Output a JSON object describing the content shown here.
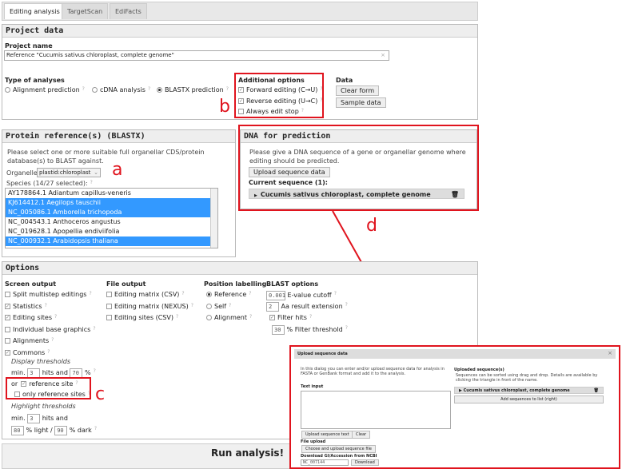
{
  "tabs": [
    "Editing analysis",
    "TargetScan",
    "EdiFacts"
  ],
  "project": {
    "header": "Project data",
    "name_label": "Project name",
    "name_value": "Reference \"Cucumis sativus chloroplast, complete genome\"",
    "clear_x": "×",
    "type_label": "Type of analyses",
    "types": [
      {
        "label": "Alignment prediction",
        "checked": false
      },
      {
        "label": "cDNA analysis",
        "checked": false
      },
      {
        "label": "BLASTX prediction",
        "checked": true
      }
    ],
    "additional_label": "Additional options",
    "additional": [
      {
        "label": "Forward editing (C→U)",
        "checked": true
      },
      {
        "label": "Reverse editing (U→C)",
        "checked": true
      },
      {
        "label": "Always edit stop",
        "checked": false
      }
    ],
    "data_label": "Data",
    "clear_form": "Clear form",
    "sample_data": "Sample data"
  },
  "protein": {
    "header": "Protein reference(s) (BLASTX)",
    "description": "Please select one or more suitable full organellar CDS/protein database(s) to BLAST against.",
    "organelle_label": "Organelle:",
    "organelle_value": "plastid:chloroplast",
    "species_label": "Species (14/27 selected):",
    "species": [
      {
        "label": "AY178864.1 Adiantum capillus-veneris",
        "selected": false
      },
      {
        "label": "KJ614412.1 Aegilops tauschii",
        "selected": true
      },
      {
        "label": "NC_005086.1 Amborella trichopoda",
        "selected": true
      },
      {
        "label": "NC_004543.1 Anthoceros angustus",
        "selected": false
      },
      {
        "label": "NC_019628.1 Apopellia endiviifolia",
        "selected": false
      },
      {
        "label": "NC_000932.1 Arabidopsis thaliana",
        "selected": true
      }
    ]
  },
  "dna": {
    "header": "DNA for prediction",
    "description": "Please give a DNA sequence of a gene or organellar genome where editing should be predicted.",
    "upload_button": "Upload sequence data",
    "current_label": "Current sequence (1):",
    "sequence": "Cucumis sativus chloroplast, complete genome"
  },
  "options": {
    "header": "Options",
    "screen_label": "Screen output",
    "screen": [
      {
        "label": "Split multistep editings",
        "checked": false
      },
      {
        "label": "Statistics",
        "checked": true
      },
      {
        "label": "Editing sites",
        "checked": true
      },
      {
        "label": "Individual base graphics",
        "checked": false
      },
      {
        "label": "Alignments",
        "checked": false
      },
      {
        "label": "Commons",
        "checked": true
      }
    ],
    "display_thresholds": "Display thresholds",
    "min": "min.",
    "min_hits": "3",
    "hits_and": "hits and",
    "percent_value": "70",
    "percent": "%",
    "or": "or",
    "reference_site": "reference site",
    "only_reference": "only reference sites",
    "highlight_thresholds": "Highlight thresholds",
    "hl_hits": "3",
    "hl_light": "80",
    "light": "% light /",
    "hl_dark": "90",
    "dark": "% dark",
    "file_label": "File output",
    "file": [
      {
        "label": "Editing matrix (CSV)",
        "checked": false
      },
      {
        "label": "Editing matrix (NEXUS)",
        "checked": false
      },
      {
        "label": "Editing sites (CSV)",
        "checked": false
      }
    ],
    "position_label": "Position labelling",
    "positions": [
      {
        "label": "Reference",
        "checked": true
      },
      {
        "label": "Self",
        "checked": false
      },
      {
        "label": "Alignment",
        "checked": false
      }
    ],
    "blast_label": "BLAST options",
    "evalue": "0.001",
    "evalue_label": "E-value cutoff",
    "aa_ext": "2",
    "aa_label": "Aa result extension",
    "filter_hits": "Filter hits",
    "filter_value": "30",
    "filter_label": "% Filter threshold"
  },
  "run": "Run analysis!",
  "dialog": {
    "title": "Upload sequence data",
    "close": "×",
    "intro": "In this dialog you can enter and/or upload sequence data for analysis in FASTA or GenBank format and add it to the analysis.",
    "text_input": "Text input",
    "upload_text": "Upload sequence text",
    "clear": "Clear",
    "file_upload": "File upload",
    "choose_file": "Choose and upload sequence file",
    "ncbi_label": "Download GI/Accession from NCBI",
    "ncbi_value": "NC_007144",
    "download": "Download",
    "uploaded_label": "Uploaded sequence(s)",
    "uploaded_desc": "Sequences can be sorted using drag and drop. Details are available by clicking the triangle in front of the name.",
    "uploaded_seq": "Cucumis sativus chloroplast, complete genome",
    "add_button": "Add sequences to list (right)"
  },
  "annotations": [
    "a",
    "b",
    "c",
    "d"
  ],
  "colors": {
    "highlight": "#e0141e",
    "selection": "#3399ff"
  }
}
